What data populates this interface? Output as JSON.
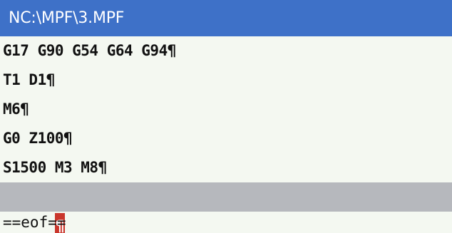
{
  "window": {
    "title": "NC:\\MPF\\3.MPF"
  },
  "program": {
    "lines": [
      "G17 G90 G54 G64 G94¶",
      "T1 D1¶",
      "M6¶",
      "G0 Z100¶",
      "S1500 M3 M8¶"
    ],
    "active_line_text": "¶",
    "eof_marker": "==eof=="
  },
  "colors": {
    "title_bar": "#3e71c8",
    "editor_background": "#f4f8f1",
    "active_line": "#b6b8bd",
    "cursor": "#c9362c"
  }
}
